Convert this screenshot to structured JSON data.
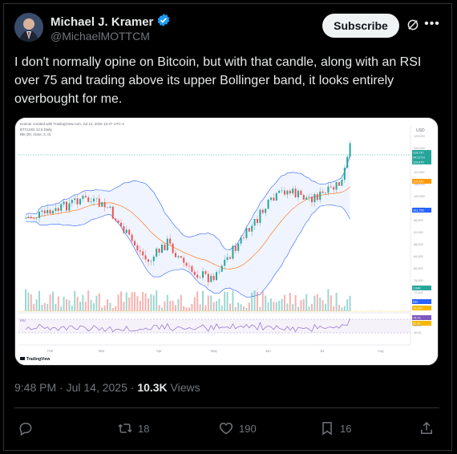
{
  "author": {
    "name": "Michael J. Kramer",
    "handle": "@MichaelMOTTCM",
    "verified": true
  },
  "header": {
    "subscribe_label": "Subscribe"
  },
  "tweet": {
    "text": "I don't normally opine on Bitcoin, but with that candle, along with an RSI over 75 and trading above its upper Bollinger band, it looks entirely overbought for me.",
    "time": "9:48 PM · Jul 14, 2025 · ",
    "views_count": "10.3K",
    "views_label": " Views"
  },
  "chart_image": {
    "attribution": "Kramer created with TradingView.com, Jul 14, 2025 15:47 UTC-4",
    "symbol_line": "BTCUSD 12.6 Daily",
    "bb_line": "BB (20, close, 2, 0)",
    "rsi_label": "RSI",
    "currency": "USD",
    "price_tags": [
      "119,737",
      "04:12:14",
      "119,679",
      "110,430",
      "101,750",
      "1.64K",
      "632",
      "76,240",
      "75.72",
      "62.62"
    ],
    "y_ticks": [
      "124,000",
      "120,000",
      "116,000",
      "112,000",
      "108,000",
      "104,000",
      "100,000",
      "96,000",
      "92,000",
      "88,000",
      "84,000",
      "80,000",
      "76,000",
      "72,000"
    ],
    "months": [
      "Feb",
      "Mar",
      "Apr",
      "May",
      "Jun",
      "Jul",
      "Aug"
    ],
    "rsi_ticks": [
      "80.00",
      "60.00",
      "40.00"
    ],
    "brand": "TradingView"
  },
  "stats": {
    "replies": "",
    "reposts": "18",
    "likes": "190",
    "bookmarks": "16"
  },
  "colors": {
    "accent": "#1d9bf0",
    "up": "#26a69a",
    "down": "#ef5350"
  }
}
